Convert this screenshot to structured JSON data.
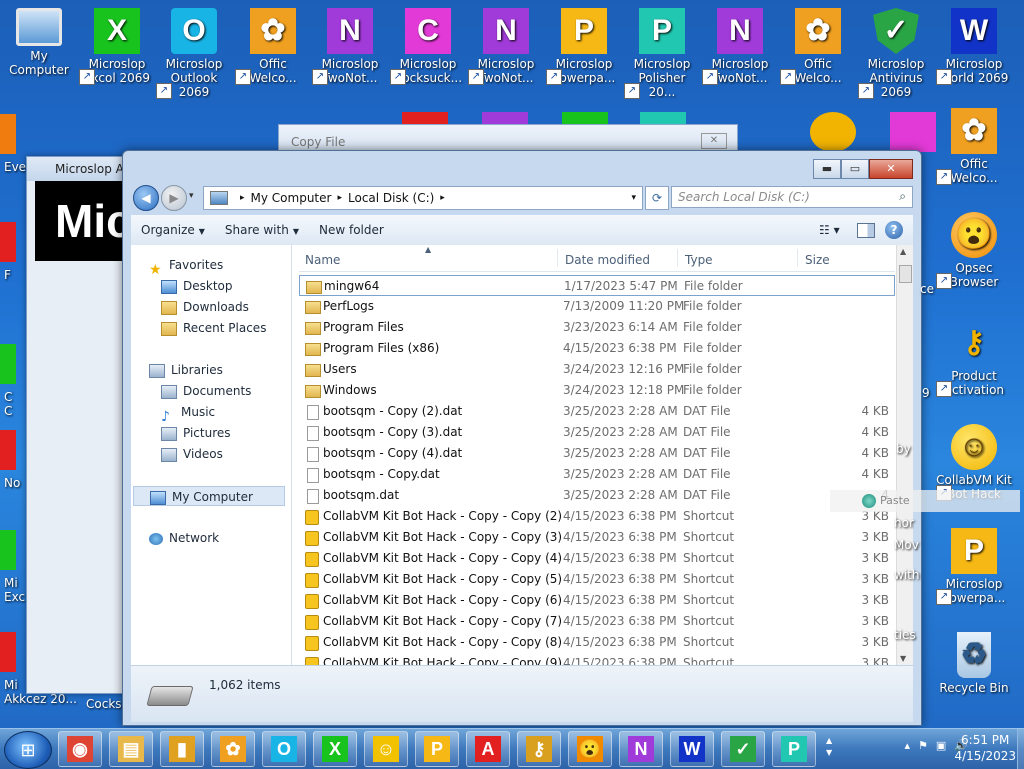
{
  "desktop": {
    "icons": [
      {
        "label": "My Computer",
        "glyph": "",
        "type": "computer"
      },
      {
        "label": "Microslop Excol 2069",
        "glyph": "X",
        "type": "x"
      },
      {
        "label": "Microslop Outlook 2069",
        "glyph": "O",
        "type": "o"
      },
      {
        "label": "Offic Welco...",
        "glyph": "✿",
        "type": "off"
      },
      {
        "label": "Microslop TwoNot...",
        "glyph": "N",
        "type": "n"
      },
      {
        "label": "Microslop Cocksuck...",
        "glyph": "C",
        "type": "c"
      },
      {
        "label": "Microslop TwoNot...",
        "glyph": "N",
        "type": "n"
      },
      {
        "label": "Microslop Powerpa...",
        "glyph": "P",
        "type": "p"
      },
      {
        "label": "Microslop Polisher 20...",
        "glyph": "P",
        "type": "pol"
      },
      {
        "label": "Microslop TwoNot...",
        "glyph": "N",
        "type": "n"
      },
      {
        "label": "Offic Welco...",
        "glyph": "✿",
        "type": "off"
      },
      {
        "label": "Microslop Antivirus 2069",
        "glyph": "✓",
        "type": "sh"
      },
      {
        "label": "Microslop World 2069",
        "glyph": "W",
        "type": "w"
      }
    ],
    "right_icons": [
      {
        "label": "Offic Welco...",
        "glyph": "✿",
        "type": "off"
      },
      {
        "label": "Opsec Browser",
        "glyph": "😮",
        "type": "wow"
      },
      {
        "label": "Product Activation",
        "glyph": "⚷",
        "type": "key"
      },
      {
        "label": "CollabVM Kit Bot Hack",
        "glyph": "☺",
        "type": "smile"
      },
      {
        "label": "Microslop Powerpa...",
        "glyph": "P",
        "type": "p"
      },
      {
        "label": "Recycle Bin",
        "glyph": "♻",
        "type": "bin"
      }
    ],
    "left_partial": [
      "Eve",
      "F",
      "C\nC",
      "No",
      "Mi\nExc",
      "Mi\nAkkcez 20...",
      "Cocksu"
    ],
    "side_snippets": [
      "ce",
      "9",
      "by",
      "hor",
      "Mov",
      "with",
      "ties"
    ]
  },
  "bg_windows": {
    "app_title": "Microslop Ar",
    "app_big_text": "Mic",
    "copy_title": "Copy File",
    "copy_close": "✕"
  },
  "explorer": {
    "controls": {
      "minimize": "▬",
      "maximize": "▭",
      "close": "✕"
    },
    "nav": {
      "back": "◀",
      "forward": "▶",
      "dropdown": "▾"
    },
    "breadcrumb": [
      "My Computer",
      "Local Disk (C:)"
    ],
    "refresh_icon": "⟳",
    "search_placeholder": "Search Local Disk (C:)",
    "toolbar": {
      "organize": "Organize",
      "share_with": "Share with",
      "new_folder": "New folder",
      "views": "☷ ▾",
      "help": "?"
    },
    "nav_pane": {
      "favorites_header": "Favorites",
      "favorites": [
        "Desktop",
        "Downloads",
        "Recent Places"
      ],
      "libraries_header": "Libraries",
      "libraries": [
        "Documents",
        "Music",
        "Pictures",
        "Videos"
      ],
      "computer": "My Computer",
      "network": "Network"
    },
    "columns": {
      "name": "Name",
      "date": "Date modified",
      "type": "Type",
      "size": "Size"
    },
    "rows": [
      {
        "name": "mingw64",
        "date": "1/17/2023 5:47 PM",
        "type": "File folder",
        "size": "",
        "icon": "folder"
      },
      {
        "name": "PerfLogs",
        "date": "7/13/2009 11:20 PM",
        "type": "File folder",
        "size": "",
        "icon": "folder"
      },
      {
        "name": "Program Files",
        "date": "3/23/2023 6:14 AM",
        "type": "File folder",
        "size": "",
        "icon": "folder"
      },
      {
        "name": "Program Files (x86)",
        "date": "4/15/2023 6:38 PM",
        "type": "File folder",
        "size": "",
        "icon": "folder"
      },
      {
        "name": "Users",
        "date": "3/24/2023 12:16 PM",
        "type": "File folder",
        "size": "",
        "icon": "folder"
      },
      {
        "name": "Windows",
        "date": "3/24/2023 12:18 PM",
        "type": "File folder",
        "size": "",
        "icon": "folder"
      },
      {
        "name": "bootsqm - Copy (2).dat",
        "date": "3/25/2023 2:28 AM",
        "type": "DAT File",
        "size": "4 KB",
        "icon": "file"
      },
      {
        "name": "bootsqm - Copy (3).dat",
        "date": "3/25/2023 2:28 AM",
        "type": "DAT File",
        "size": "4 KB",
        "icon": "file"
      },
      {
        "name": "bootsqm - Copy (4).dat",
        "date": "3/25/2023 2:28 AM",
        "type": "DAT File",
        "size": "4 KB",
        "icon": "file"
      },
      {
        "name": "bootsqm - Copy.dat",
        "date": "3/25/2023 2:28 AM",
        "type": "DAT File",
        "size": "4 KB",
        "icon": "file"
      },
      {
        "name": "bootsqm.dat",
        "date": "3/25/2023 2:28 AM",
        "type": "DAT File",
        "size": "4",
        "icon": "file"
      },
      {
        "name": "CollabVM Kit Bot Hack - Copy - Copy (2)",
        "date": "4/15/2023 6:38 PM",
        "type": "Shortcut",
        "size": "3 KB",
        "icon": "shortcut"
      },
      {
        "name": "CollabVM Kit Bot Hack - Copy - Copy (3)",
        "date": "4/15/2023 6:38 PM",
        "type": "Shortcut",
        "size": "3 KB",
        "icon": "shortcut"
      },
      {
        "name": "CollabVM Kit Bot Hack - Copy - Copy (4)",
        "date": "4/15/2023 6:38 PM",
        "type": "Shortcut",
        "size": "3 KB",
        "icon": "shortcut"
      },
      {
        "name": "CollabVM Kit Bot Hack - Copy - Copy (5)",
        "date": "4/15/2023 6:38 PM",
        "type": "Shortcut",
        "size": "3 KB",
        "icon": "shortcut"
      },
      {
        "name": "CollabVM Kit Bot Hack - Copy - Copy (6)",
        "date": "4/15/2023 6:38 PM",
        "type": "Shortcut",
        "size": "3 KB",
        "icon": "shortcut"
      },
      {
        "name": "CollabVM Kit Bot Hack - Copy - Copy (7)",
        "date": "4/15/2023 6:38 PM",
        "type": "Shortcut",
        "size": "3 KB",
        "icon": "shortcut"
      },
      {
        "name": "CollabVM Kit Bot Hack - Copy - Copy (8)",
        "date": "4/15/2023 6:38 PM",
        "type": "Shortcut",
        "size": "3 KB",
        "icon": "shortcut"
      },
      {
        "name": "CollabVM Kit Bot Hack - Copy - Copy (9)",
        "date": "4/15/2023 6:38 PM",
        "type": "Shortcut",
        "size": "3 KB",
        "icon": "shortcut"
      }
    ],
    "status_count": "1,062 items"
  },
  "drag_label": "Paste",
  "taskbar": {
    "start_glyph": "⊞",
    "buttons": [
      {
        "name": "chrome",
        "glyph": "◉",
        "bg": "#dd4433"
      },
      {
        "name": "explorer",
        "glyph": "▤",
        "bg": "#e8b94a"
      },
      {
        "name": "app-yellow",
        "glyph": "▮",
        "bg": "#e0a020"
      },
      {
        "name": "offic",
        "glyph": "✿",
        "bg": "#f0a020"
      },
      {
        "name": "outlook",
        "glyph": "O",
        "bg": "#19b4e6"
      },
      {
        "name": "excol",
        "glyph": "X",
        "bg": "#19c31e"
      },
      {
        "name": "collab",
        "glyph": "☺",
        "bg": "#f2c200"
      },
      {
        "name": "powerpa",
        "glyph": "P",
        "bg": "#f6b814"
      },
      {
        "name": "app-a",
        "glyph": "A",
        "bg": "#e22020"
      },
      {
        "name": "key",
        "glyph": "⚷",
        "bg": "#d9a020"
      },
      {
        "name": "opsec",
        "glyph": "😮",
        "bg": "#f08a00"
      },
      {
        "name": "twonot",
        "glyph": "N",
        "bg": "#a03ad8"
      },
      {
        "name": "world",
        "glyph": "W",
        "bg": "#1233c8"
      },
      {
        "name": "antivirus",
        "glyph": "✓",
        "bg": "#2aa545"
      },
      {
        "name": "polisher",
        "glyph": "P",
        "bg": "#21c7b0"
      }
    ],
    "tray": [
      "▴",
      "⚑",
      "▣",
      "🔊"
    ],
    "time": "6:51 PM",
    "date": "4/15/2023"
  }
}
